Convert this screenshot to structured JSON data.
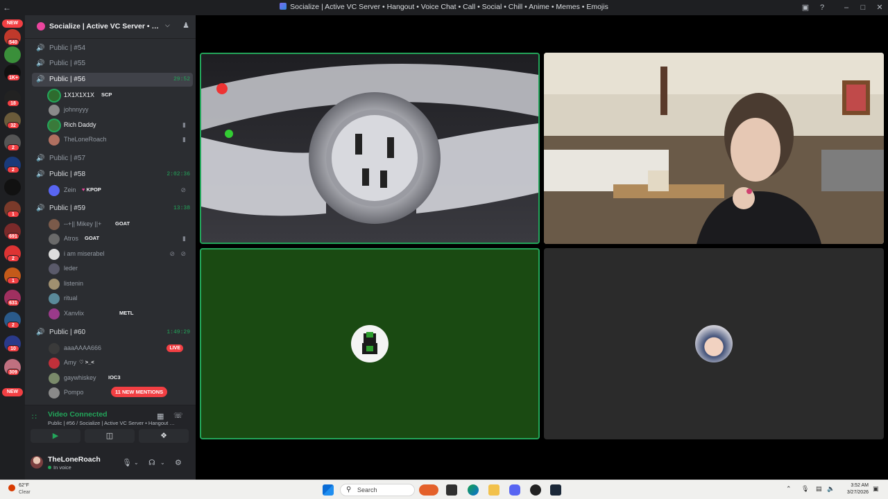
{
  "window": {
    "title": "Socialize | Active VC Server • Hangout • Voice Chat • Call • Social • Chill • Anime • Memes • Emojis"
  },
  "rail": {
    "top_label": "NEW",
    "bottom_label": "NEW",
    "badges": [
      "540",
      "1K+",
      "18",
      "32",
      "2",
      "2",
      "1",
      "691",
      "2",
      "1",
      "1",
      "631",
      "2",
      "10",
      "309"
    ]
  },
  "guild": {
    "name": "Socialize | Active VC Server • Hangout • Voice Chat"
  },
  "channels": [
    {
      "name": "Public | #54"
    },
    {
      "name": "Public | #55"
    },
    {
      "name": "Public | #56",
      "timer": "29:52"
    },
    {
      "name": "Public | #57"
    },
    {
      "name": "Public | #58",
      "timer": "2:02:36"
    },
    {
      "name": "Public | #59",
      "timer": "13:38"
    },
    {
      "name": "Public | #60",
      "timer": "1:49:29"
    }
  ],
  "members": {
    "c56": [
      {
        "name": "1X1X1X1X",
        "tag": "SCP"
      },
      {
        "name": "johnnyyy"
      },
      {
        "name": "Rich Daddy"
      },
      {
        "name": "TheLoneRoach"
      }
    ],
    "c58": [
      {
        "name": "Zein",
        "tag": "KPOP"
      }
    ],
    "c59": [
      {
        "name": "--+|| Mikey ||+",
        "tag": "GOAT"
      },
      {
        "name": "Atros",
        "tag": "GOAT"
      },
      {
        "name": "i am miserabel"
      },
      {
        "name": "leder"
      },
      {
        "name": "listenin"
      },
      {
        "name": "ritual"
      },
      {
        "name": "Xanvlix",
        "tag": "METL"
      }
    ],
    "c60": [
      {
        "name": "aaaAAAA666",
        "badge": "LIVE"
      },
      {
        "name": "Amy",
        "tag": "♡ >_<"
      },
      {
        "name": "gaywhiskey",
        "tag": "IOC3"
      },
      {
        "name": "Pompo"
      }
    ]
  },
  "mentions_pill": "11 NEW MENTIONS",
  "voice": {
    "status": "Video Connected",
    "location": "Public | #56 / Socialize | Active VC Server • Hangout • Voice Chat"
  },
  "user": {
    "name": "TheLoneRoach",
    "status": "In voice"
  },
  "taskbar": {
    "weather_temp": "62°F",
    "weather_cond": "Clear",
    "search_placeholder": "Search",
    "time": "3:52 AM",
    "date": "3/27/2026"
  },
  "colors": {
    "accent_green": "#23a55a",
    "danger_red": "#f23f43",
    "sidebar": "#2b2d31",
    "rail": "#1e1f22"
  },
  "icons": {
    "speaker": "speaker-icon",
    "camera": "camera-icon",
    "screen_share": "screen-share-icon",
    "activities": "activities-icon",
    "mic": "microphone-icon",
    "headphones": "headphones-icon",
    "settings": "gear-icon"
  }
}
